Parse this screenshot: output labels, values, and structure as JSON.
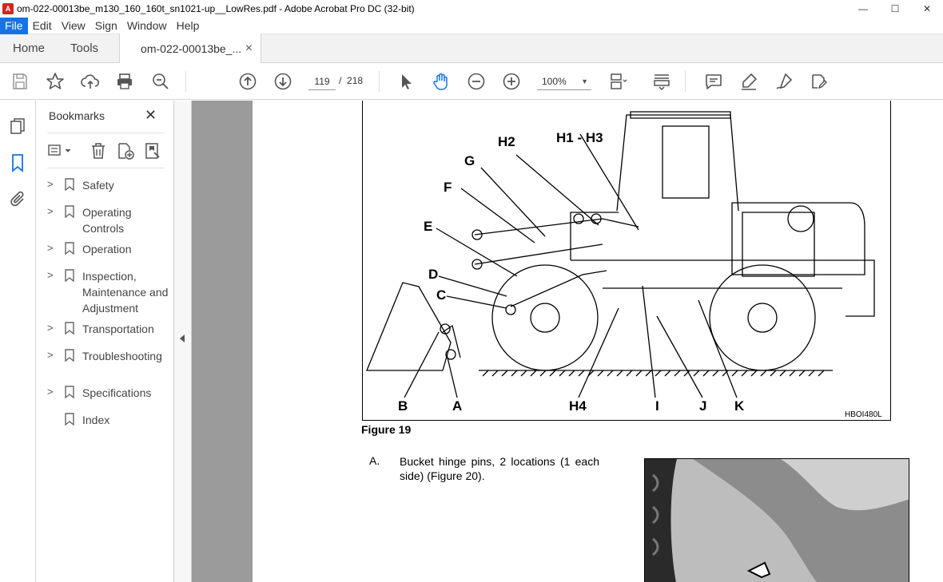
{
  "window": {
    "title": "om-022-00013be_m130_160_160t_sn1021-up__LowRes.pdf - Adobe Acrobat Pro DC (32-bit)",
    "app_icon": "pdf-icon",
    "controls": [
      "—",
      "☐",
      "✕"
    ]
  },
  "menu": {
    "items": [
      "File",
      "Edit",
      "View",
      "Sign",
      "Window",
      "Help"
    ],
    "active": "File"
  },
  "tabs": {
    "home": "Home",
    "tools": "Tools",
    "document": "om-022-00013be_...",
    "close": "×"
  },
  "toolbar": {
    "page_current": "119",
    "page_separator": "/",
    "page_total": "218",
    "zoom": "100%",
    "icons": [
      "save-icon",
      "star-icon",
      "upload-icon",
      "print-icon",
      "search-zoom-icon",
      "page-up-icon",
      "page-down-icon",
      "select-arrow-icon",
      "hand-icon",
      "zoom-out-icon",
      "zoom-in-icon",
      "zoom-dropdown-icon",
      "page-layout-icon",
      "scroll-icon",
      "comment-icon",
      "highlight-icon",
      "sign-icon",
      "fill-sign-icon"
    ]
  },
  "bookmarks": {
    "title": "Bookmarks",
    "close": "✕",
    "items": [
      {
        "label": "Safety",
        "expandable": true
      },
      {
        "label": "Operating Controls",
        "expandable": true
      },
      {
        "label": "Operation",
        "expandable": true
      },
      {
        "label": "Inspection, Maintenance and Adjustment",
        "expandable": true
      },
      {
        "label": "Transportation",
        "expandable": true
      },
      {
        "label": "Troubleshooting",
        "expandable": true
      },
      {
        "label": "Specifications",
        "expandable": true
      },
      {
        "label": "Index",
        "expandable": false
      }
    ]
  },
  "document": {
    "figure_callouts": [
      "H2",
      "H1 - H3",
      "G",
      "F",
      "E",
      "D",
      "C",
      "B",
      "A",
      "H4",
      "I",
      "J",
      "K"
    ],
    "figure_code": "HBOI480L",
    "figure_label": "Figure 19",
    "item_letter": "A.",
    "item_text": "Bucket hinge pins, 2 locations (1 each side) (Figure 20)."
  }
}
